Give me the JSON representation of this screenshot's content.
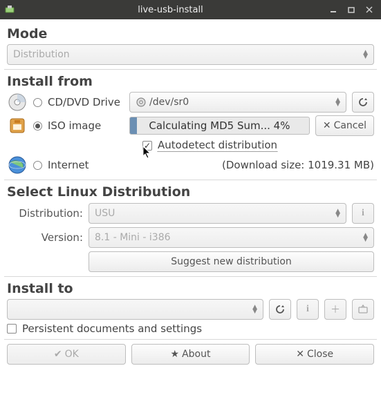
{
  "window": {
    "title": "live-usb-install"
  },
  "mode": {
    "heading": "Mode",
    "value": "Distribution"
  },
  "install_from": {
    "heading": "Install from",
    "options": {
      "cd": {
        "label": "CD/DVD Drive",
        "checked": false,
        "device": "/dev/sr0"
      },
      "iso": {
        "label": "ISO image",
        "checked": true
      },
      "internet": {
        "label": "Internet",
        "checked": false
      }
    },
    "progress": {
      "text": "Calculating MD5 Sum... 4%",
      "percent": 4
    },
    "cancel": "Cancel",
    "autodetect": {
      "label": "Autodetect distribution",
      "checked": true
    },
    "download_size": "(Download size: 1019.31 MB)"
  },
  "select_dist": {
    "heading": "Select Linux Distribution",
    "dist_label": "Distribution:",
    "dist_value": "USU",
    "ver_label": "Version:",
    "ver_value": "8.1 - Mini - i386",
    "suggest": "Suggest new distribution"
  },
  "install_to": {
    "heading": "Install to",
    "value": "",
    "persistent": {
      "label": "Persistent documents and settings",
      "checked": false
    }
  },
  "buttons": {
    "ok": "OK",
    "about": "About",
    "close": "Close"
  },
  "colors": {
    "titlebar": "#3a3a38",
    "progress_fill": "#6b8fb3"
  }
}
